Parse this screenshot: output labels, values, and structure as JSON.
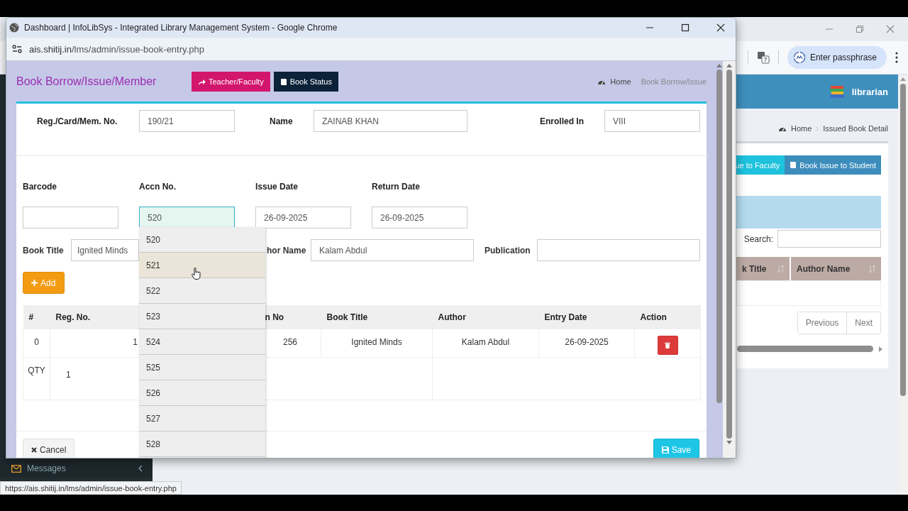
{
  "background_window": {
    "passphrase_button": "Enter passphrase",
    "user": "librarian",
    "breadcrumb": [
      "Home",
      "Issued Book Detail"
    ],
    "buttons": [
      {
        "label": "ue to Faculty",
        "kind": "faculty"
      },
      {
        "label": "Book Issue to Student",
        "kind": "student"
      }
    ],
    "search_label": "Search:",
    "columns": [
      "k Title",
      "Author Name"
    ],
    "pagination": [
      "Previous",
      "Next"
    ],
    "sidebar_item": "Messages"
  },
  "window": {
    "title": "Dashboard | InfoLibSys - Integrated Library Management System - Google Chrome",
    "url_host": "ais.shitij.in",
    "url_path": "/lms/admin/issue-book-entry.php"
  },
  "page": {
    "heading": "Book Borrow/Issue/Member",
    "header_buttons": [
      {
        "label": "Teacher/Faculty",
        "kind": "teacher"
      },
      {
        "label": "Book Status",
        "kind": "status"
      }
    ],
    "breadcrumb": [
      "Home",
      "Book Borrow/Issue"
    ],
    "member_fields": [
      {
        "label": "Reg./Card/Mem. No.",
        "value": "190/21"
      },
      {
        "label": "Name",
        "value": "ZAINAB KHAN"
      },
      {
        "label": "Enrolled In",
        "value": "VIII"
      }
    ],
    "book_fields": [
      {
        "label": "Barcode",
        "focused": false
      },
      {
        "label": "Accn No.",
        "value": "520",
        "focused": true
      },
      {
        "label": "Issue Date",
        "value": "26-09-2025",
        "focused": false
      },
      {
        "label": "Return Date",
        "value": "26-09-2025",
        "focused": false
      }
    ],
    "detail_fields": [
      {
        "label": "Book Title",
        "value": "Ignited Minds"
      },
      {
        "label": "hor Name",
        "value": "Kalam Abdul"
      },
      {
        "label": "Publication"
      }
    ],
    "add_button": "Add",
    "table": {
      "columns": [
        "#",
        "Reg. No.",
        "n No",
        "Book Title",
        "Author",
        "Entry Date",
        "Action"
      ],
      "rows": [
        {
          "index": "0",
          "reg_no": "1",
          "accn_no": "256",
          "book_title": "Ignited Minds",
          "author": "Kalam Abdul",
          "entry_date": "26-09-2025"
        }
      ],
      "qty_label": "QTY",
      "qty": "1"
    },
    "suggestions": [
      {
        "text": "520",
        "selected": false
      },
      {
        "text": "521",
        "selected": true
      },
      {
        "text": "522",
        "selected": false
      },
      {
        "text": "523",
        "selected": false
      },
      {
        "text": "524",
        "selected": false
      },
      {
        "text": "525",
        "selected": false
      },
      {
        "text": "526",
        "selected": false
      },
      {
        "text": "527",
        "selected": false
      },
      {
        "text": "528",
        "selected": false
      }
    ],
    "cancel_button": "Cancel",
    "save_button": "Save"
  },
  "status_url": "https://ais.shitij.in/lms/admin/issue-book-entry.php"
}
